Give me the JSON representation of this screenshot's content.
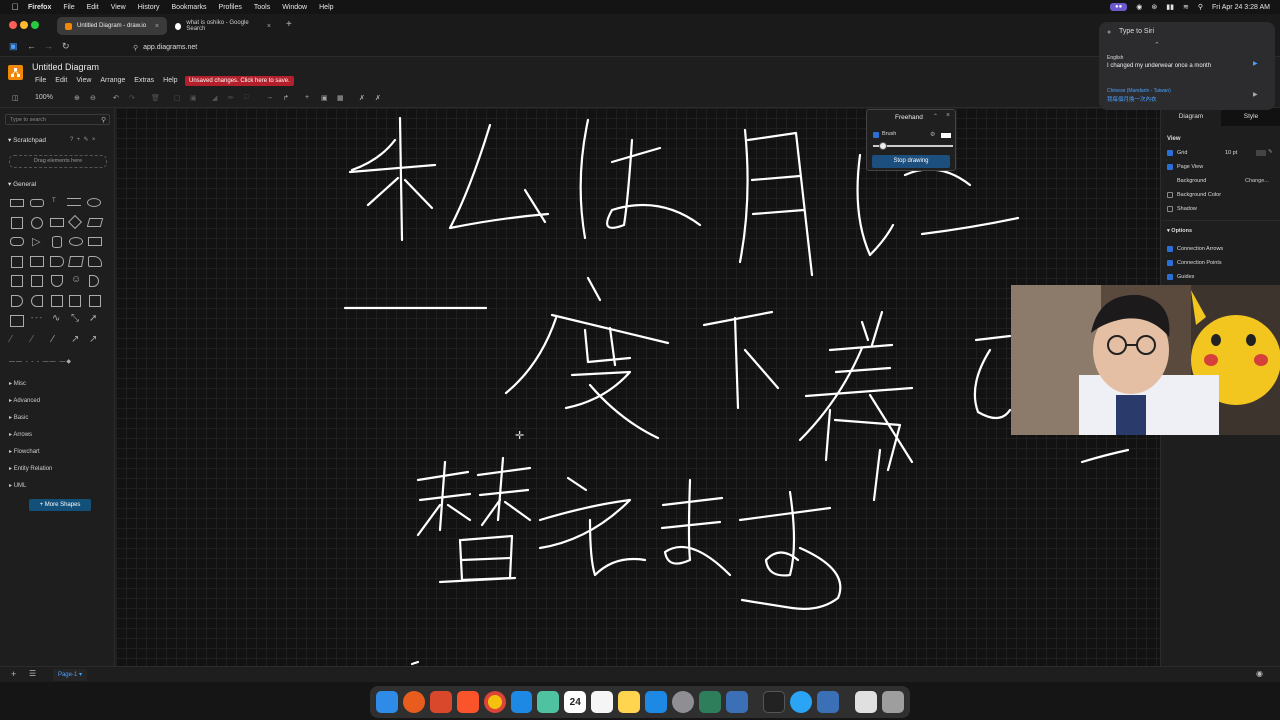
{
  "menubar": {
    "app": "Firefox",
    "items": [
      "File",
      "Edit",
      "View",
      "History",
      "Bookmarks",
      "Profiles",
      "Tools",
      "Window",
      "Help"
    ],
    "datetime": "Fri Apr 24  3:28 AM"
  },
  "tabs": [
    {
      "title": "Untitled Diagram - draw.io"
    },
    {
      "title": "what is oshiko - Google Search"
    }
  ],
  "url": "app.diagrams.net",
  "drawio": {
    "doc_title": "Untitled Diagram",
    "menu": [
      "File",
      "Edit",
      "View",
      "Arrange",
      "Extras",
      "Help"
    ],
    "unsaved": "Unsaved changes. Click here to save.",
    "zoom": "100%"
  },
  "sidebar": {
    "search_placeholder": "Type to search",
    "scratchpad": "Scratchpad",
    "drop_hint": "Drag elements here",
    "general": "General",
    "categories": [
      "Misc",
      "Advanced",
      "Basic",
      "Arrows",
      "Flowchart",
      "Entity Relation",
      "UML"
    ],
    "more_shapes": "+ More Shapes"
  },
  "freehand": {
    "title": "Freehand",
    "brush": "Brush",
    "stop": "Stop drawing"
  },
  "right_panel": {
    "tab_diagram": "Diagram",
    "tab_style": "Style",
    "view": "View",
    "grid": "Grid",
    "grid_size": "10 pt",
    "page_view": "Page View",
    "background": "Background",
    "change": "Change...",
    "background_color": "Background Color",
    "shadow": "Shadow",
    "options": "Options",
    "connection_arrows": "Connection Arrows",
    "connection_points": "Connection Points",
    "guides": "Guides"
  },
  "siri": {
    "placeholder": "Type to Siri",
    "lang1": "English",
    "text1": "I changed my underwear once a month",
    "lang2": "Chinese (Mandarin - Taiwan)",
    "text2": "我每個月換一次內衣"
  },
  "page_tab": "Page-1",
  "dock_calendar_day": "24",
  "colors": {
    "accent": "#2b6fd6",
    "unsaved": "#b3202b",
    "logo": "#f08705",
    "ink": "#ffffff"
  }
}
